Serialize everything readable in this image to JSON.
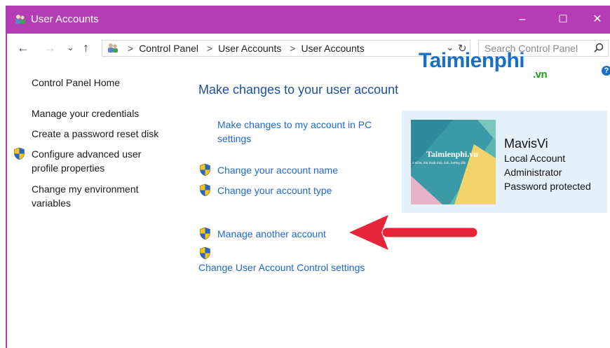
{
  "window": {
    "title": "User Accounts",
    "minimize_label": "–",
    "maximize_label": "☐",
    "close_label": "✕",
    "accent_color": "#b43db6"
  },
  "nav": {
    "back": "←",
    "forward": "→",
    "recent": "⌄",
    "up": "↑",
    "breadcrumbs": [
      "Control Panel",
      "User Accounts",
      "User Accounts"
    ],
    "separator": ">",
    "dropdown": "⌄",
    "refresh": "↻"
  },
  "search": {
    "placeholder": "Search Control Panel"
  },
  "watermark": {
    "main": "Taimienphi",
    "suffix": ".vn"
  },
  "help_label": "?",
  "sidebar": {
    "items": [
      {
        "label": "Control Panel Home"
      },
      {
        "label": "Manage your credentials"
      },
      {
        "label": "Create a password reset disk"
      },
      {
        "label_line1": "Configure advanced user",
        "label_line2": "profile properties",
        "icon": "shield-icon"
      },
      {
        "label_line1": "Change my environment",
        "label_line2": "variables"
      }
    ]
  },
  "main": {
    "heading": "Make changes to your user account",
    "links": [
      {
        "line1": "Make changes to my account in PC",
        "line2": "settings"
      },
      {
        "label": "Change your account name",
        "icon": "shield-icon"
      },
      {
        "label": "Change your account type",
        "icon": "shield-icon"
      },
      {
        "label": "Manage another account",
        "icon": "shield-icon"
      },
      {
        "label": "Change User Account Control settings",
        "icon": "shield-icon"
      }
    ]
  },
  "account": {
    "name": "MavisVi",
    "type": "Local Account",
    "role": "Administrator",
    "status": "Password protected",
    "avatar_text": "Taimienphi.vn",
    "avatar_subtext": "a mềm, thủ thuật máy tính, hướng dẫn"
  },
  "annotation": {
    "arrow_color": "#e8243b"
  }
}
